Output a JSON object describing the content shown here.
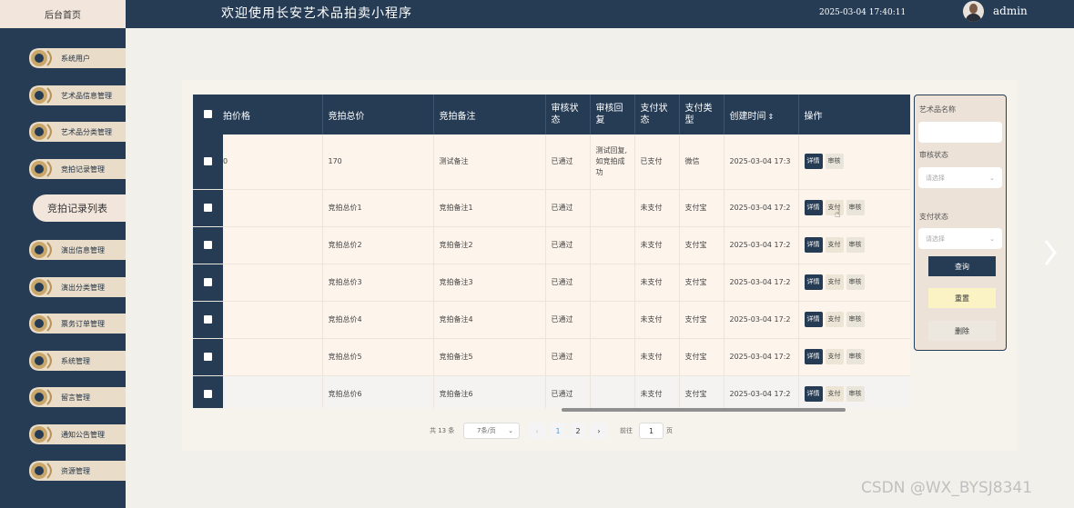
{
  "header": {
    "home_tab": "后台首页",
    "title": "欢迎使用长安艺术品拍卖小程序",
    "datetime": "2025-03-04 17:40:11",
    "username": "admin"
  },
  "sidebar": {
    "items": [
      {
        "label": "系统用户"
      },
      {
        "label": "艺术品信息管理"
      },
      {
        "label": "艺术品分类管理"
      },
      {
        "label": "竞拍记录管理"
      },
      {
        "label": "演出信息管理"
      },
      {
        "label": "演出分类管理"
      },
      {
        "label": "票务订单管理"
      },
      {
        "label": "系统管理"
      },
      {
        "label": "留言管理"
      },
      {
        "label": "通知公告管理"
      },
      {
        "label": "资源管理"
      }
    ],
    "active_item": "竞拍记录列表"
  },
  "table": {
    "columns": [
      "拍价格",
      "竞拍总价",
      "竞拍备注",
      "审核状态",
      "审核回复",
      "支付状态",
      "支付类型",
      "创建时间",
      "操作"
    ],
    "sort_icon": "sort-icon",
    "rows": [
      {
        "price": "0",
        "total": "170",
        "remark": "测试备注",
        "audit": "已通过",
        "reply": "测试回复,如竞拍成功",
        "pay": "已支付",
        "paytype": "微信",
        "created": "2025-03-04 17:3",
        "actions": [
          "详情",
          "审核"
        ]
      },
      {
        "price": "",
        "total": "竞拍总价1",
        "remark": "竞拍备注1",
        "audit": "已通过",
        "reply": "",
        "pay": "未支付",
        "paytype": "支付宝",
        "created": "2025-03-04 17:2",
        "actions": [
          "详情",
          "支付",
          "审核"
        ]
      },
      {
        "price": "",
        "total": "竞拍总价2",
        "remark": "竞拍备注2",
        "audit": "已通过",
        "reply": "",
        "pay": "未支付",
        "paytype": "支付宝",
        "created": "2025-03-04 17:2",
        "actions": [
          "详情",
          "支付",
          "审核"
        ]
      },
      {
        "price": "",
        "total": "竞拍总价3",
        "remark": "竞拍备注3",
        "audit": "已通过",
        "reply": "",
        "pay": "未支付",
        "paytype": "支付宝",
        "created": "2025-03-04 17:2",
        "actions": [
          "详情",
          "支付",
          "审核"
        ]
      },
      {
        "price": "",
        "total": "竞拍总价4",
        "remark": "竞拍备注4",
        "audit": "已通过",
        "reply": "",
        "pay": "未支付",
        "paytype": "支付宝",
        "created": "2025-03-04 17:2",
        "actions": [
          "详情",
          "支付",
          "审核"
        ]
      },
      {
        "price": "",
        "total": "竞拍总价5",
        "remark": "竞拍备注5",
        "audit": "已通过",
        "reply": "",
        "pay": "未支付",
        "paytype": "支付宝",
        "created": "2025-03-04 17:2",
        "actions": [
          "详情",
          "支付",
          "审核"
        ]
      },
      {
        "price": "",
        "total": "竞拍总价6",
        "remark": "竞拍备注6",
        "audit": "已通过",
        "reply": "",
        "pay": "未支付",
        "paytype": "支付宝",
        "created": "2025-03-04 17:2",
        "actions": [
          "详情",
          "支付",
          "审核"
        ]
      }
    ]
  },
  "pagination": {
    "total": "共 13 条",
    "page_size": "7条/页",
    "prev": "‹",
    "pages": [
      "1",
      "2"
    ],
    "current_page": "1",
    "next": "›",
    "goto_label": "前往",
    "goto_value": "1",
    "unit": "页"
  },
  "search": {
    "name_label": "艺术品名称",
    "name_value": "",
    "audit_label": "审核状态",
    "audit_placeholder": "请选择",
    "pay_label": "支付状态",
    "pay_placeholder": "请选择",
    "query_btn": "查询",
    "reset_btn": "重置",
    "delete_btn": "删除"
  },
  "colors": {
    "navy": "#263c55",
    "cream": "#f2e6dc",
    "row_bg": "#fdf4ec",
    "reset_bg": "#fbf3c4"
  },
  "watermark": "CSDN @WX_BYSJ8341"
}
